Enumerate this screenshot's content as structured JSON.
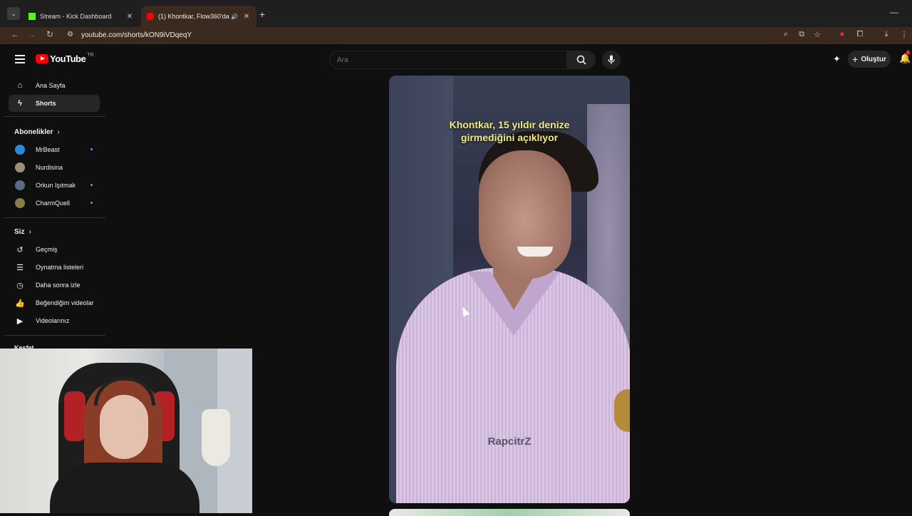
{
  "browser": {
    "tabs": [
      {
        "title": "Stream - Kick Dashboard",
        "favicon_color": "#53fc18"
      },
      {
        "title": "(1) Khontkar, Flow360'da 15",
        "favicon_color": "#ff0000"
      }
    ],
    "url": "youtube.com/shorts/kON9iVDqeqY"
  },
  "youtube": {
    "logo_text": "YouTube",
    "country_code": "TR",
    "search_placeholder": "Ara",
    "create_label": "Oluştur",
    "notification_count": "1"
  },
  "sidebar": {
    "main": [
      {
        "label": "Ana Sayfa",
        "icon": "home-icon"
      },
      {
        "label": "Shorts",
        "icon": "shorts-icon"
      }
    ],
    "subscriptions_title": "Abonelikler",
    "subscriptions": [
      {
        "label": "MrBeast",
        "avatar_color": "#2b8ad6"
      },
      {
        "label": "Nurdisina",
        "avatar_color": "#9a8f7a"
      },
      {
        "label": "Orkun Işıtmak",
        "avatar_color": "#5a6c85"
      },
      {
        "label": "CharmQuell",
        "avatar_color": "#8b7d4a"
      }
    ],
    "you_title": "Siz",
    "you": [
      {
        "label": "Geçmiş",
        "icon": "history-icon"
      },
      {
        "label": "Oynatma listeleri",
        "icon": "playlists-icon"
      },
      {
        "label": "Daha sonra izle",
        "icon": "watch-later-icon"
      },
      {
        "label": "Beğendiğim videolar",
        "icon": "liked-icon"
      },
      {
        "label": "Videolarınız",
        "icon": "your-videos-icon"
      }
    ],
    "explore_title": "Keşfet"
  },
  "short": {
    "caption_line1": "Khontkar, 15 yıldır denize",
    "caption_line2": "girmediğini açıklıyor",
    "watermark": "RapcitrZ"
  }
}
